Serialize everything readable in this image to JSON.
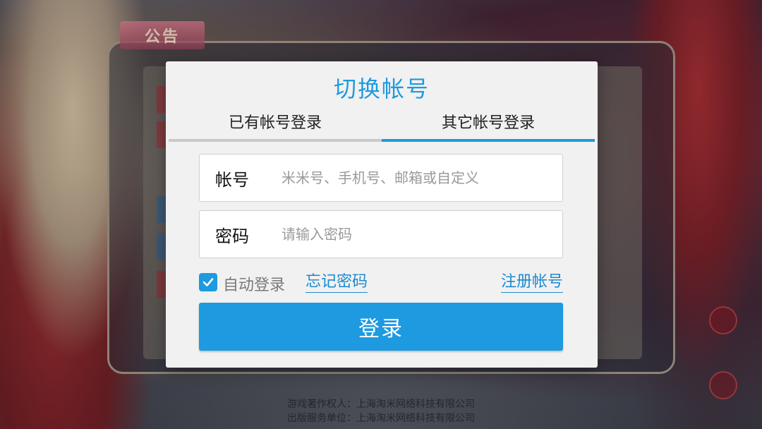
{
  "background": {
    "notice_title": "公告",
    "copyright_author": "游戏著作权人：上海淘米网络科技有限公司",
    "copyright_publisher": "出版服务单位：上海淘米网络科技有限公司"
  },
  "dialog": {
    "title": "切换帐号",
    "tabs": [
      {
        "label": "已有帐号登录",
        "active": false
      },
      {
        "label": "其它帐号登录",
        "active": true
      }
    ],
    "account": {
      "label": "帐号",
      "placeholder": "米米号、手机号、邮箱或自定义",
      "value": ""
    },
    "password": {
      "label": "密码",
      "placeholder": "请输入密码",
      "value": ""
    },
    "auto_login": {
      "label": "自动登录",
      "checked": true
    },
    "forgot_password": "忘记密码",
    "register": "注册帐号",
    "login_button": "登录"
  },
  "colors": {
    "accent": "#1d9ae0",
    "tab_inactive_line": "#c9c9c9",
    "dialog_bg": "#f1f1f1"
  }
}
